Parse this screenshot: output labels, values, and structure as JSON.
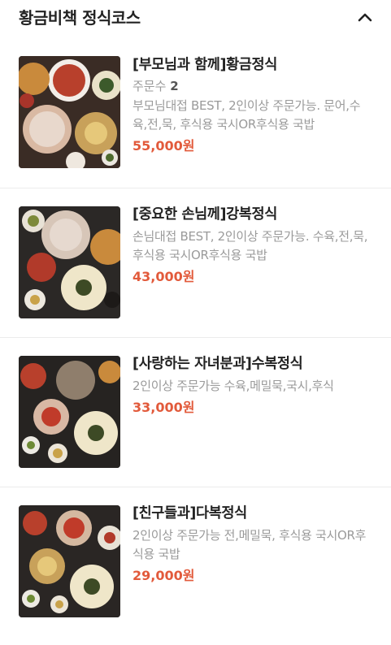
{
  "section": {
    "title": "황금비책 정식코스",
    "toggle_icon": "chevron-up-icon"
  },
  "colors": {
    "price": "#e25a3b",
    "title": "#222222",
    "muted": "#9a9a9a",
    "divider": "#ececec"
  },
  "items": [
    {
      "title": "[부모님과 함께]황금정식",
      "order_label": "주문수",
      "order_count": "2",
      "description": "부모님대접 BEST, 2인이상 주문가능. 문어,수육,전,묵, 후식용 국시OR후식용 국밥",
      "price": "55,000원"
    },
    {
      "title": "[중요한 손님께]강복정식",
      "description": "손님대접 BEST, 2인이상 주문가능. 수육,전,묵, 후식용 국시OR후식용 국밥",
      "price": "43,000원"
    },
    {
      "title": "[사랑하는 자녀분과]수복정식",
      "description": "2인이상 주문가능 수육,메밀묵,국시,후식",
      "price": "33,000원"
    },
    {
      "title": "[친구들과]다복정식",
      "description": "2인이상 주문가능 전,메밀묵, 후식용 국시OR후식용 국밥",
      "price": "29,000원"
    }
  ]
}
